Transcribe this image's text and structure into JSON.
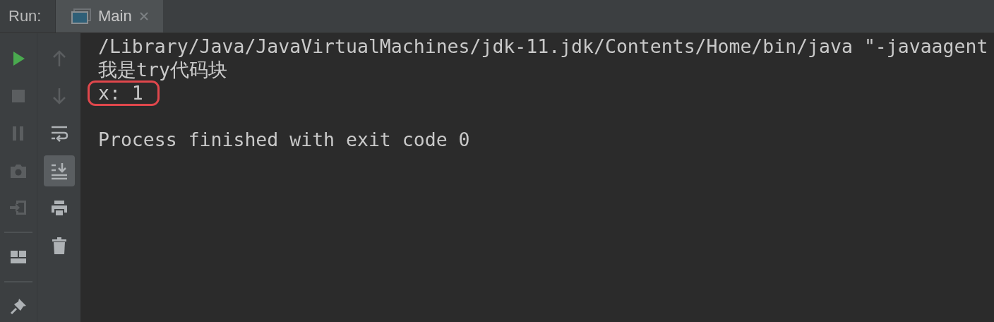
{
  "header": {
    "label": "Run:",
    "tabs": [
      {
        "label": "Main",
        "selected": true
      }
    ]
  },
  "left_toolbar": [
    {
      "kind": "run",
      "disabled": false
    },
    {
      "kind": "stop",
      "disabled": true
    },
    {
      "kind": "pause",
      "disabled": true
    },
    {
      "kind": "camera",
      "disabled": true
    },
    {
      "kind": "exit",
      "disabled": true
    },
    {
      "kind": "separator"
    },
    {
      "kind": "layout",
      "disabled": false
    },
    {
      "kind": "separator"
    },
    {
      "kind": "pin",
      "disabled": false
    }
  ],
  "right_toolbar": [
    {
      "kind": "up",
      "disabled": true,
      "selected": false
    },
    {
      "kind": "down",
      "disabled": true,
      "selected": false
    },
    {
      "kind": "wrap",
      "disabled": false,
      "selected": false
    },
    {
      "kind": "scroll",
      "disabled": false,
      "selected": true
    },
    {
      "kind": "print",
      "disabled": false,
      "selected": false
    },
    {
      "kind": "trash",
      "disabled": false,
      "selected": false
    }
  ],
  "console": [
    {
      "text": "/Library/Java/JavaVirtualMachines/jdk-11.jdk/Contents/Home/bin/java \"-javaagent",
      "highlighted": false
    },
    {
      "text": "我是try代码块",
      "highlighted": false
    },
    {
      "text": "x: 1",
      "highlighted": true
    },
    {
      "text": "Process finished with exit code 0",
      "highlighted": false,
      "blank_line_before": true
    }
  ]
}
